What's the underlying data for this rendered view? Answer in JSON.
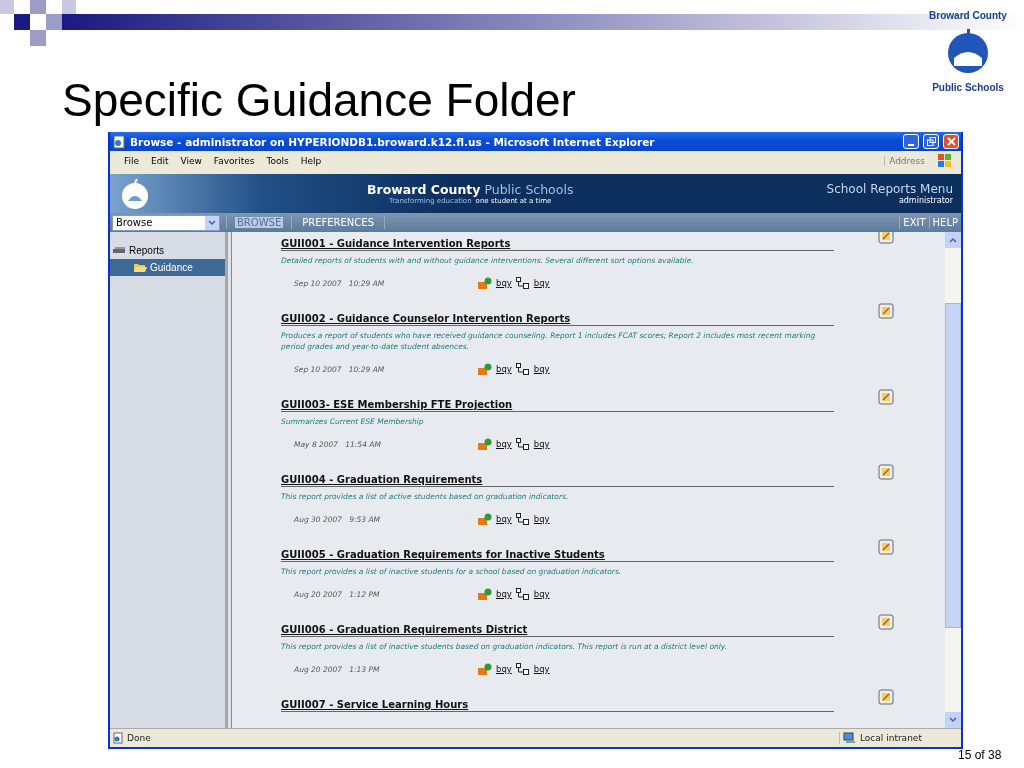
{
  "slide": {
    "title": "Specific Guidance Folder",
    "logo_top": "Broward County",
    "logo_bottom": "Public Schools",
    "page": "15 of 38"
  },
  "window": {
    "title": "Browse - administrator on HYPERIONDB1.broward.k12.fl.us - Microsoft Internet Explorer"
  },
  "menu": [
    "File",
    "Edit",
    "View",
    "Favorites",
    "Tools",
    "Help"
  ],
  "address_label": "Address",
  "banner": {
    "name_bold": "Broward County",
    "name_light": "Public Schools",
    "tagline_a": "Transforming education",
    "tagline_b": "one student at a time",
    "menu_title": "School Reports Menu",
    "user": "administrator"
  },
  "nav": {
    "dropdown": "Browse",
    "tabs": [
      {
        "label": "BROWSE",
        "selected": true
      },
      {
        "label": "PREFERENCES",
        "selected": false
      }
    ],
    "links": [
      "EXIT",
      "HELP"
    ]
  },
  "tree": [
    {
      "label": "Reports",
      "selected": false,
      "children": [
        {
          "label": "Guidance",
          "selected": true
        }
      ]
    }
  ],
  "reports": [
    {
      "title": "GUII001 - Guidance Intervention Reports",
      "description": "Detailed reports of students with and without guidance interventions. Several different sort options available.",
      "date": "Sep 10 2007   10:29 AM",
      "links": [
        "bqy",
        "bqy"
      ]
    },
    {
      "title": "GUII002 - Guidance Counselor Intervention Reports",
      "description": "Produces a report of students who have received guidance counseling. Report 1 includes FCAT scores; Report 2 includes most recent marking period grades and year-to-date student absences.",
      "date": "Sep 10 2007   10:29 AM",
      "links": [
        "bqy",
        "bqy"
      ]
    },
    {
      "title": "GUII003- ESE Membership FTE Projection",
      "description": "Summarizes Current ESE Membership",
      "date": "May 8 2007   11:54 AM",
      "links": [
        "bqy",
        "bqy"
      ]
    },
    {
      "title": "GUII004 - Graduation Requirements",
      "description": "This report provides a list of active students based on graduation indicators.",
      "date": "Aug 30 2007   9:53 AM",
      "links": [
        "bqy",
        "bqy"
      ]
    },
    {
      "title": "GUII005 - Graduation Requirements for Inactive Students",
      "description": "This report provides a list of inactive students for a school based on graduation indicators.",
      "date": "Aug 20 2007   1:12 PM",
      "links": [
        "bqy",
        "bqy"
      ]
    },
    {
      "title": "GUII006 - Graduation Requirements District",
      "description": "This report provides a list of inactive students based on graduation indicators. This report is run at a district level only.",
      "date": "Aug 20 2007   1:13 PM",
      "links": [
        "bqy",
        "bqy"
      ]
    },
    {
      "title": "GUII007 - Service Learning Hours"
    }
  ],
  "status_bar": {
    "text": "Done",
    "zone": "Local intranet"
  }
}
